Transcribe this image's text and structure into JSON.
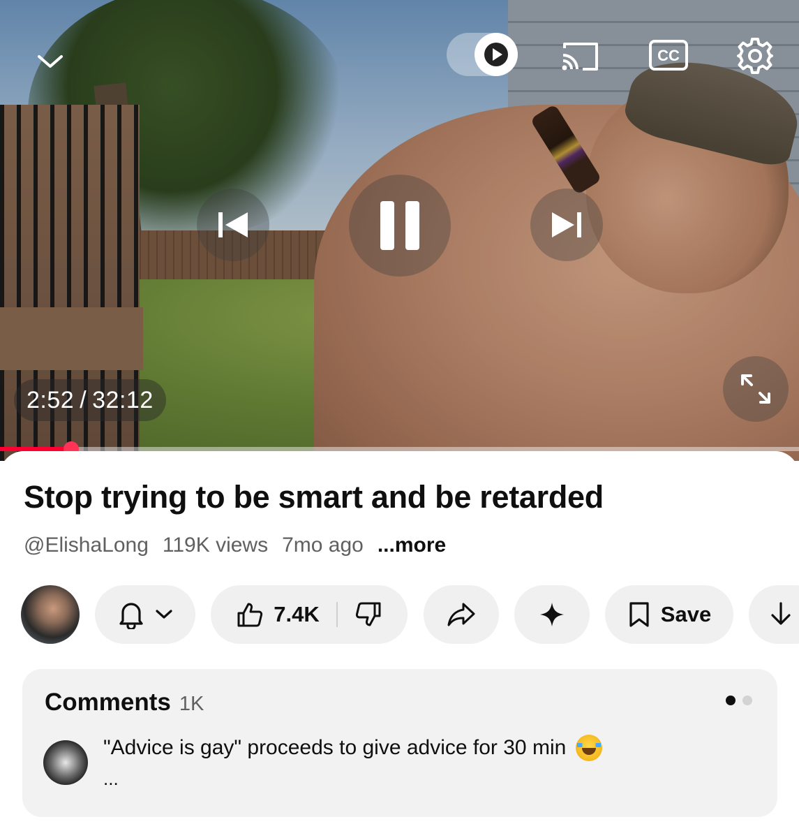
{
  "player": {
    "current_time": "2:52",
    "time_separator": "/",
    "duration": "32:12",
    "progress": 0.089,
    "autoplay_on": true,
    "cc_label": "CC",
    "icons": {
      "collapse": "chevron-down-icon",
      "autoplay": "autoplay-toggle",
      "cast": "cast-icon",
      "captions": "cc-icon",
      "settings": "gear-icon",
      "previous": "skip-previous-icon",
      "pause": "pause-icon",
      "next": "skip-next-icon",
      "fullscreen": "fullscreen-icon"
    },
    "progress_color": "#ff0033"
  },
  "video": {
    "title": "Stop trying to be smart and be retarded",
    "channel": "@ElishaLong",
    "views": "119K views",
    "age": "7mo ago",
    "more": "...more"
  },
  "actions": {
    "likes": "7.4K",
    "save_label": "Save",
    "icons": {
      "subscribe": "bell-icon",
      "like": "thumbs-up-icon",
      "dislike": "thumbs-down-icon",
      "share": "share-icon",
      "ask": "sparkle-icon",
      "save": "bookmark-icon",
      "download": "download-icon"
    }
  },
  "comments": {
    "title": "Comments",
    "count": "1K",
    "top_comment": "\"Advice is gay\" proceeds to give advice for 30 min",
    "ellipsis": "...",
    "emoji": "face-with-tears-of-joy"
  }
}
